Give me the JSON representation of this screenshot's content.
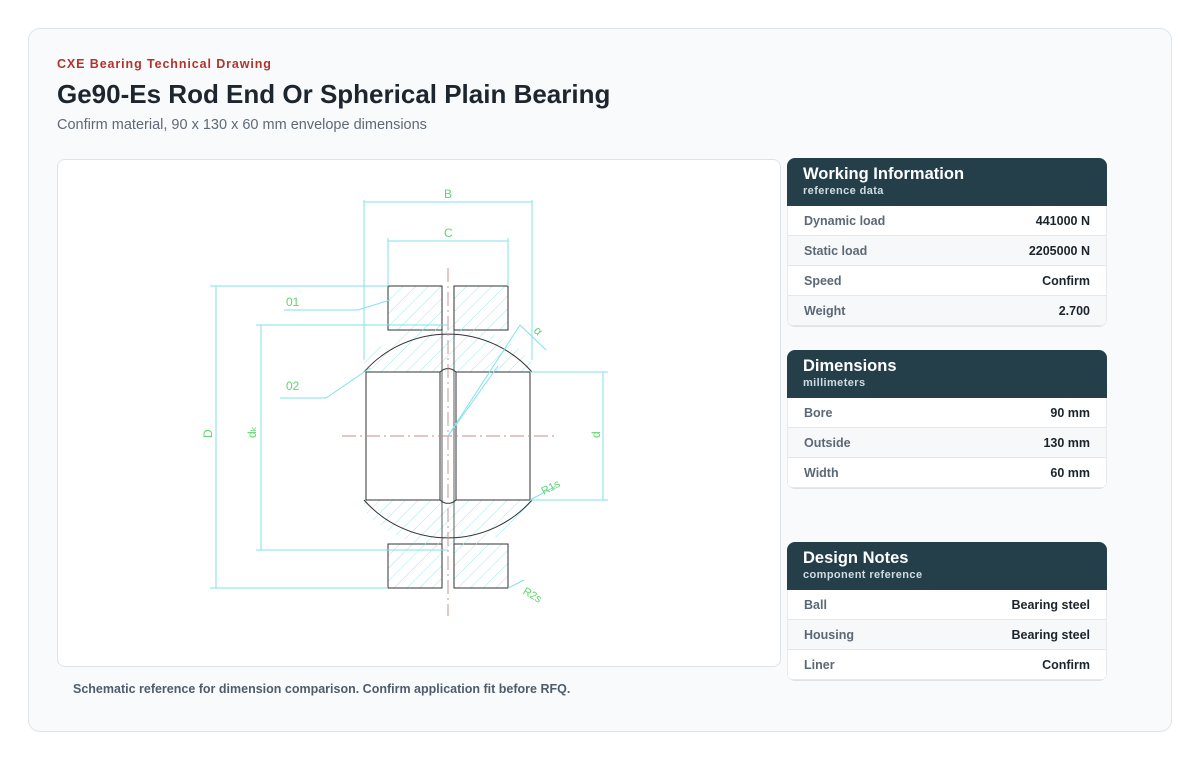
{
  "header": {
    "eyebrow": "CXE Bearing Technical Drawing",
    "title": "Ge90-Es Rod End Or Spherical Plain Bearing",
    "subtitle": "Confirm material, 90 x 130 x 60 mm envelope dimensions"
  },
  "drawing": {
    "labels": {
      "B": "B",
      "C": "C",
      "D": "D",
      "dk": "dₖ",
      "d": "d",
      "a": "α",
      "r1s": "R1s",
      "r2s": "R2s",
      "part01": "01",
      "part02": "02"
    },
    "colors": {
      "dimension": "#7fe3ea",
      "label": "#5fd66f",
      "outline": "#333333",
      "hatch": "#9ee8ee",
      "centerline": "#c98a8a"
    },
    "caption": "Schematic reference for dimension comparison. Confirm application fit before RFQ."
  },
  "panels": {
    "working": {
      "title": "Working Information",
      "subtitle": "reference data",
      "rows": [
        {
          "label": "Dynamic load",
          "value": "441000 N"
        },
        {
          "label": "Static load",
          "value": "2205000 N"
        },
        {
          "label": "Speed",
          "value": "Confirm"
        },
        {
          "label": "Weight",
          "value": "2.700"
        }
      ]
    },
    "dimensions": {
      "title": "Dimensions",
      "subtitle": "millimeters",
      "rows": [
        {
          "label": "Bore",
          "value": "90 mm"
        },
        {
          "label": "Outside",
          "value": "130 mm"
        },
        {
          "label": "Width",
          "value": "60 mm"
        }
      ]
    },
    "notes": {
      "title": "Design Notes",
      "subtitle": "component reference",
      "rows": [
        {
          "label": "Ball",
          "value": "Bearing steel"
        },
        {
          "label": "Housing",
          "value": "Bearing steel"
        },
        {
          "label": "Liner",
          "value": "Confirm"
        }
      ]
    }
  }
}
